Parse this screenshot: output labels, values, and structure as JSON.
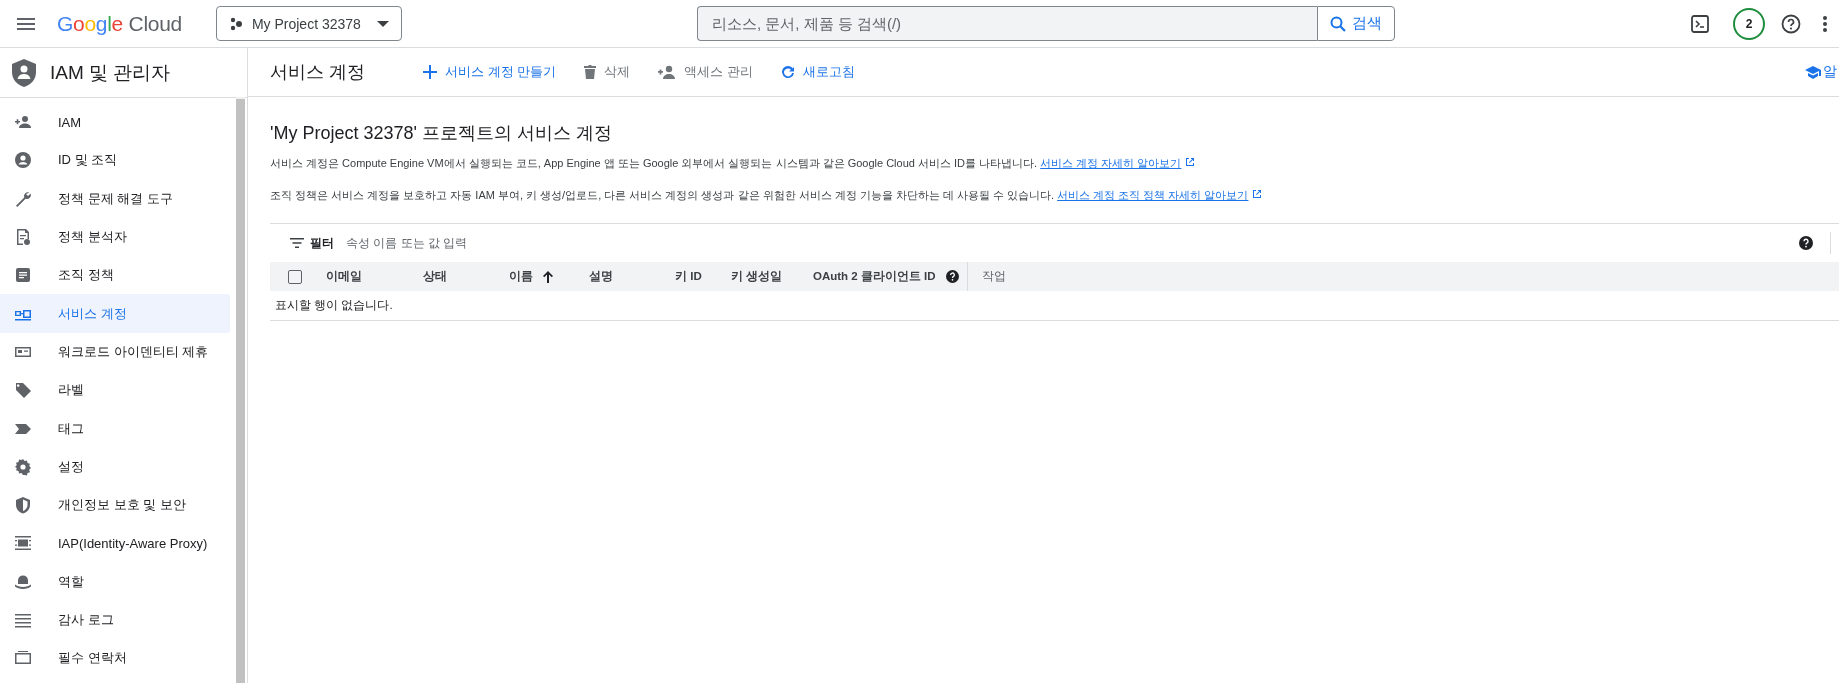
{
  "topbar": {
    "brand": "Google",
    "product": "Cloud",
    "project": "My Project 32378",
    "search": {
      "placeholder": "리소스, 문서, 제품 등 검색(/)",
      "button": "검색"
    },
    "notifications": "2"
  },
  "sidebar": {
    "title": "IAM 및 관리자",
    "items": [
      {
        "label": "IAM",
        "selected": false
      },
      {
        "label": "ID 및 조직",
        "selected": false
      },
      {
        "label": "정책 문제 해결 도구",
        "selected": false
      },
      {
        "label": "정책 분석자",
        "selected": false
      },
      {
        "label": "조직 정책",
        "selected": false
      },
      {
        "label": "서비스 계정",
        "selected": true
      },
      {
        "label": "워크로드 아이덴티티 제휴",
        "selected": false
      },
      {
        "label": "라벨",
        "selected": false
      },
      {
        "label": "태그",
        "selected": false
      },
      {
        "label": "설정",
        "selected": false
      },
      {
        "label": "개인정보 보호 및 보안",
        "selected": false
      },
      {
        "label": "IAP(Identity-Aware Proxy)",
        "selected": false
      },
      {
        "label": "역할",
        "selected": false
      },
      {
        "label": "감사 로그",
        "selected": false
      },
      {
        "label": "필수 연락처",
        "selected": false
      }
    ]
  },
  "page_header": {
    "title": "서비스 계정",
    "actions": [
      {
        "kind": "create",
        "label": "서비스 계정 만들기",
        "disabled": false
      },
      {
        "kind": "delete",
        "label": "삭제",
        "disabled": true
      },
      {
        "kind": "access",
        "label": "액세스 관리",
        "disabled": true
      },
      {
        "kind": "refresh",
        "label": "새로고침",
        "disabled": false
      }
    ],
    "learn": "알"
  },
  "content": {
    "heading": "'My Project 32378' 프로젝트의 서비스 계정",
    "paragraphs": [
      {
        "text": "서비스 계정은 Compute Engine VM에서 실행되는 코드, App Engine 앱 또는 Google 외부에서 실행되는 시스템과 같은 Google Cloud 서비스 ID를 나타냅니다.",
        "link": "서비스 계정 자세히 알아보기"
      },
      {
        "text": "조직 정책은 서비스 계정을 보호하고 자동 IAM 부여, 키 생성/업로드, 다른 서비스 계정의 생성과 같은 위험한 서비스 계정 기능을 차단하는 데 사용될 수 있습니다.",
        "link": "서비스 계정 조직 정책 자세히 알아보기"
      }
    ]
  },
  "filter": {
    "label": "필터",
    "placeholder": "속성 이름 또는 값 입력"
  },
  "table": {
    "select_all": {
      "checked": false
    },
    "columns": [
      {
        "label": "이메일",
        "sorted": false,
        "help": false
      },
      {
        "label": "상태",
        "sorted": false,
        "help": false
      },
      {
        "label": "이름",
        "sorted": true,
        "help": false
      },
      {
        "label": "설명",
        "sorted": false,
        "help": false
      },
      {
        "label": "키 ID",
        "sorted": false,
        "help": false
      },
      {
        "label": "키 생성일",
        "sorted": false,
        "help": false
      },
      {
        "label": "OAuth 2 클라이언트 ID",
        "sorted": false,
        "help": true
      },
      {
        "label": "작업",
        "sorted": false,
        "help": false
      }
    ],
    "empty_message": "표시할 행이 없습니다."
  }
}
